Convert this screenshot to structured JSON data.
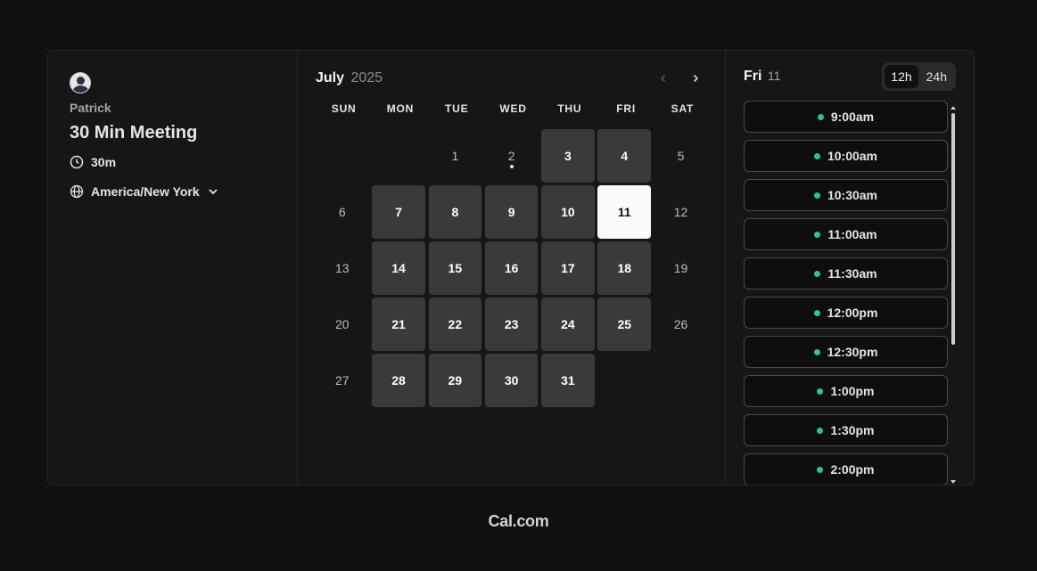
{
  "profile": {
    "name": "Patrick"
  },
  "event": {
    "title": "30 Min Meeting",
    "duration": "30m",
    "timezone": "America/New York"
  },
  "calendar": {
    "month": "July",
    "year": "2025",
    "weekdays": [
      "SUN",
      "MON",
      "TUE",
      "WED",
      "THU",
      "FRI",
      "SAT"
    ],
    "leading_blanks": 2,
    "days": [
      {
        "n": "1",
        "state": "disabled"
      },
      {
        "n": "2",
        "state": "disabled",
        "dot": true
      },
      {
        "n": "3",
        "state": "avail"
      },
      {
        "n": "4",
        "state": "avail"
      },
      {
        "n": "5",
        "state": "disabled"
      },
      {
        "n": "6",
        "state": "disabled"
      },
      {
        "n": "7",
        "state": "avail"
      },
      {
        "n": "8",
        "state": "avail"
      },
      {
        "n": "9",
        "state": "avail"
      },
      {
        "n": "10",
        "state": "avail"
      },
      {
        "n": "11",
        "state": "selected"
      },
      {
        "n": "12",
        "state": "disabled"
      },
      {
        "n": "13",
        "state": "disabled"
      },
      {
        "n": "14",
        "state": "avail"
      },
      {
        "n": "15",
        "state": "avail"
      },
      {
        "n": "16",
        "state": "avail"
      },
      {
        "n": "17",
        "state": "avail"
      },
      {
        "n": "18",
        "state": "avail"
      },
      {
        "n": "19",
        "state": "disabled"
      },
      {
        "n": "20",
        "state": "disabled"
      },
      {
        "n": "21",
        "state": "avail"
      },
      {
        "n": "22",
        "state": "avail"
      },
      {
        "n": "23",
        "state": "avail"
      },
      {
        "n": "24",
        "state": "avail"
      },
      {
        "n": "25",
        "state": "avail"
      },
      {
        "n": "26",
        "state": "disabled"
      },
      {
        "n": "27",
        "state": "disabled"
      },
      {
        "n": "28",
        "state": "avail"
      },
      {
        "n": "29",
        "state": "avail"
      },
      {
        "n": "30",
        "state": "avail"
      },
      {
        "n": "31",
        "state": "avail"
      }
    ]
  },
  "slots": {
    "day_label": "Fri",
    "day_number": "11",
    "format_options": [
      "12h",
      "24h"
    ],
    "selected_format": "12h",
    "times": [
      "9:00am",
      "10:00am",
      "10:30am",
      "11:00am",
      "11:30am",
      "12:00pm",
      "12:30pm",
      "1:00pm",
      "1:30pm",
      "2:00pm"
    ],
    "available_color": "#2fc68a"
  },
  "footer": {
    "brand": "Cal.com"
  },
  "colors": {
    "selected_day_bg": "#fafafa",
    "available_day_bg": "#3a3a3a"
  }
}
